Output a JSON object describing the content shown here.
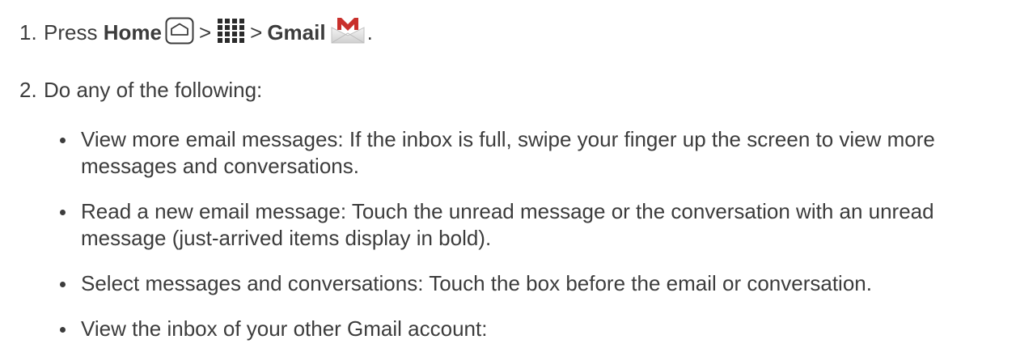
{
  "steps": [
    {
      "number": "1.",
      "press": "Press",
      "home": "Home",
      "separator": ">",
      "gmail": "Gmail",
      "period": "."
    },
    {
      "number": "2.",
      "text": "Do any of the following:"
    }
  ],
  "icons": {
    "home": "home-button-icon",
    "apps": "apps-grid-icon",
    "gmail": "gmail-envelope-icon"
  },
  "colors": {
    "text": "#3c3c3c",
    "gmail_red": "#c9302c"
  },
  "bullets": [
    "View more email messages: If the inbox is full, swipe your finger up the screen to view more messages and conversations.",
    "Read a new email message: Touch the unread message or the conversation with an unread message (just-arrived items display in bold).",
    "Select messages and conversations: Touch the box before the email or conversation.",
    "View the inbox of your other Gmail account:"
  ]
}
